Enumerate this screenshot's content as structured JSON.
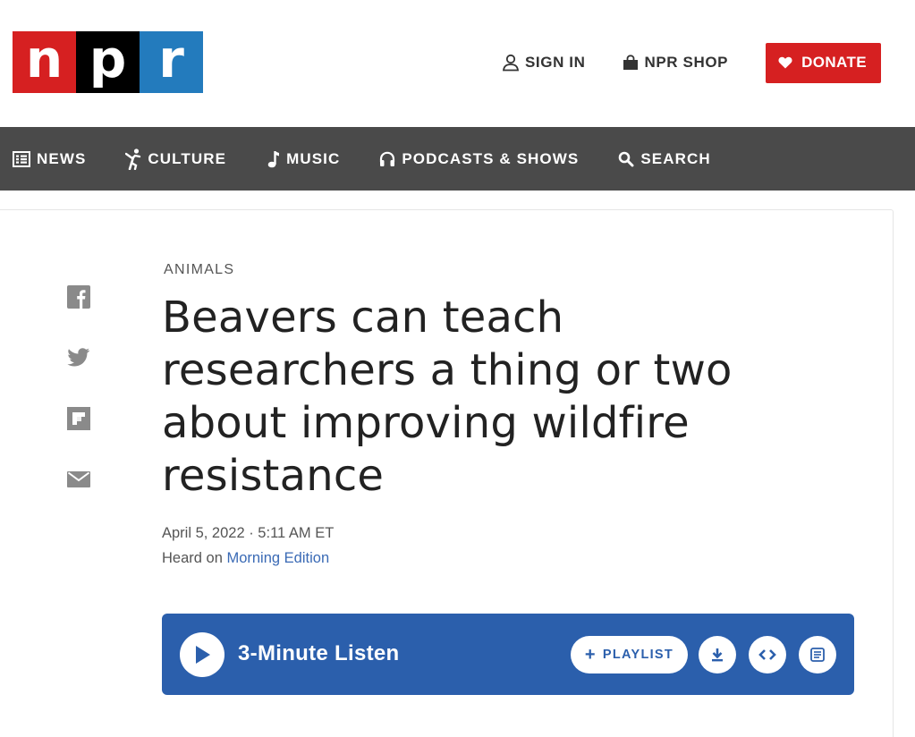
{
  "logo": {
    "letters": [
      "n",
      "p",
      "r"
    ]
  },
  "top": {
    "sign_in": "SIGN IN",
    "shop": "NPR SHOP",
    "donate": "DONATE"
  },
  "nav": [
    {
      "label": "NEWS",
      "icon": "news-icon"
    },
    {
      "label": "CULTURE",
      "icon": "culture-icon"
    },
    {
      "label": "MUSIC",
      "icon": "music-icon"
    },
    {
      "label": "PODCASTS & SHOWS",
      "icon": "headphones-icon"
    },
    {
      "label": "SEARCH",
      "icon": "search-icon"
    }
  ],
  "article": {
    "slug": "ANIMALS",
    "headline": "Beavers can teach researchers a thing or two about improving wildfire resistance",
    "date": "April 5, 2022 · 5:11 AM ET",
    "heard_on_prefix": "Heard on ",
    "heard_on_show": "Morning Edition"
  },
  "share": [
    "facebook-icon",
    "twitter-icon",
    "flipboard-icon",
    "email-icon"
  ],
  "player": {
    "title": "3-Minute Listen",
    "playlist_label": "PLAYLIST",
    "playlist_symbol": "+"
  },
  "colors": {
    "npr_red": "#d62021",
    "npr_black": "#000000",
    "npr_blue": "#237bbd",
    "nav_bg": "#4a4a4a",
    "player_bg": "#2b5fac",
    "link": "#3a6ab5"
  }
}
